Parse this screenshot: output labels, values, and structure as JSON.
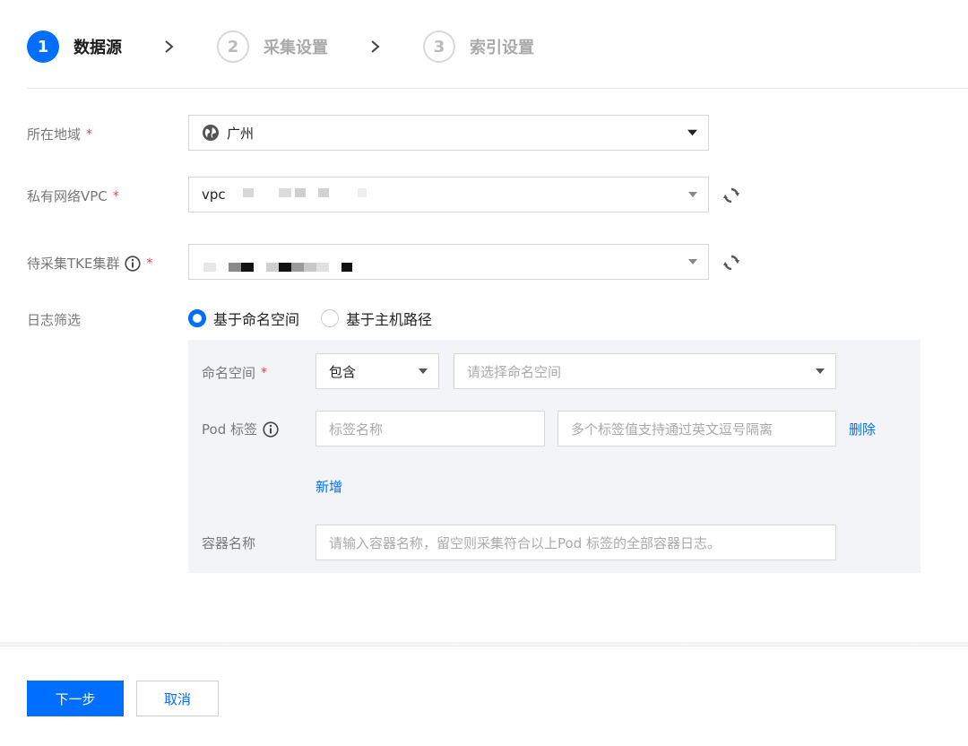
{
  "steps": [
    {
      "num": "1",
      "label": "数据源",
      "state": "active"
    },
    {
      "num": "2",
      "label": "采集设置",
      "state": "inactive"
    },
    {
      "num": "3",
      "label": "索引设置",
      "state": "inactive"
    }
  ],
  "form": {
    "region": {
      "label": "所在地域",
      "required": "*",
      "value": "广州",
      "icon": "globe-icon"
    },
    "vpc": {
      "label": "私有网络VPC",
      "required": "*",
      "value": "vpc",
      "icon": "refresh-icon"
    },
    "cluster": {
      "label": "待采集TKE集群",
      "required": "*",
      "icon": "info-icon"
    },
    "log_filter": {
      "label": "日志筛选",
      "options": [
        {
          "label": "基于命名空间",
          "selected": true
        },
        {
          "label": "基于主机路径",
          "selected": false
        }
      ]
    }
  },
  "panel": {
    "namespace": {
      "label": "命名空间",
      "required": "*",
      "mode": "包含",
      "placeholder": "请选择命名空间"
    },
    "pod_label": {
      "label": "Pod 标签",
      "name_placeholder": "标签名称",
      "value_placeholder": "多个标签值支持通过英文逗号隔离",
      "delete": "删除"
    },
    "add": "新增",
    "container": {
      "label": "容器名称",
      "placeholder": "请输入容器名称，留空则采集符合以上Pod 标签的全部容器日志。"
    }
  },
  "footer": {
    "next": "下一步",
    "cancel": "取消"
  },
  "colors": {
    "primary": "#006eff",
    "required": "#e54545",
    "panel_bg": "#f3f4f7"
  }
}
